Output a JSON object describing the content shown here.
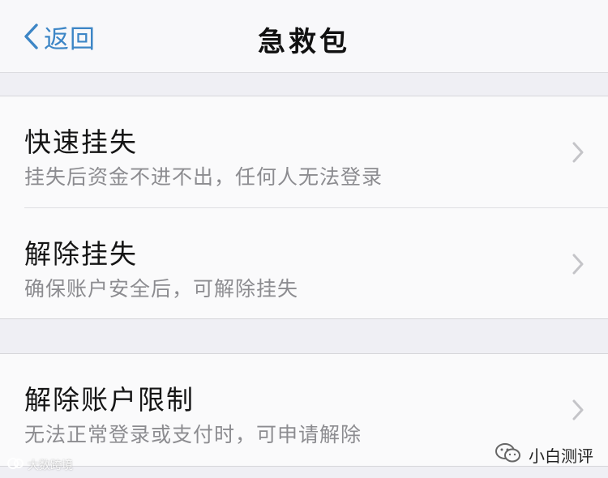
{
  "navbar": {
    "back_label": "返回",
    "title": "急救包"
  },
  "groups": [
    {
      "items": [
        {
          "title": "快速挂失",
          "subtitle": "挂失后资金不进不出，任何人无法登录"
        },
        {
          "title": "解除挂失",
          "subtitle": "确保账户安全后，可解除挂失"
        }
      ]
    },
    {
      "items": [
        {
          "title": "解除账户限制",
          "subtitle": "无法正常登录或支付时，可申请解除"
        }
      ]
    }
  ],
  "watermarks": {
    "left": "大数跨境",
    "right": "小白测评"
  },
  "icons": {
    "back": "chevron-left-icon",
    "row_arrow": "chevron-right-icon",
    "wechat": "wechat-icon"
  },
  "colors": {
    "accent": "#3d86c6",
    "background": "#efeff4",
    "cell": "#fafafb",
    "subtitle": "#8c8c90",
    "chevron": "#c4c4c8"
  }
}
